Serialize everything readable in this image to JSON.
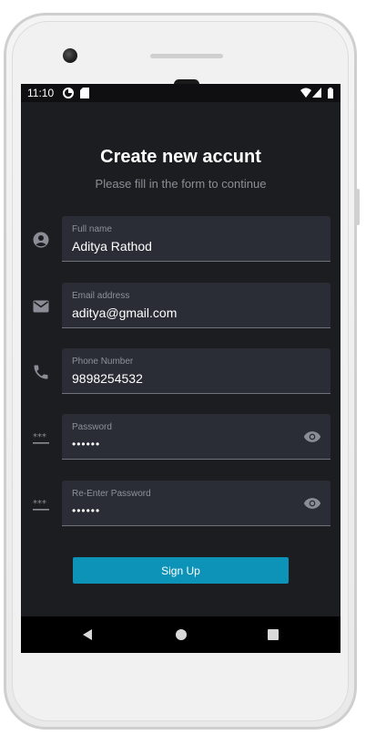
{
  "statusbar": {
    "time": "11:10",
    "icons": [
      "data-saver-icon",
      "sd-card-icon",
      "wifi-icon",
      "signal-icon",
      "battery-icon"
    ]
  },
  "form": {
    "title": "Create new accunt",
    "subtitle": "Please fill in the form to continue",
    "fields": [
      {
        "label": "Full name",
        "value": "Aditya Rathod",
        "icon": "person-icon"
      },
      {
        "label": "Email address",
        "value": "aditya@gmail.com",
        "icon": "email-icon"
      },
      {
        "label": "Phone Number",
        "value": "9898254532",
        "icon": "phone-icon"
      },
      {
        "label": "Password",
        "value": "••••••",
        "icon": "password-icon",
        "trailing_icon": "eye-icon"
      },
      {
        "label": "Re-Enter Password",
        "value": "••••••",
        "icon": "password-icon",
        "trailing_icon": "eye-icon"
      }
    ],
    "submit_label": "Sign Up"
  },
  "navbar": {
    "buttons": [
      "back-icon",
      "home-icon",
      "recents-icon"
    ]
  },
  "colors": {
    "background": "#1c1d21",
    "field_bg": "#2a2d35",
    "accent": "#0e93b8",
    "icon": "#8a8d95"
  }
}
